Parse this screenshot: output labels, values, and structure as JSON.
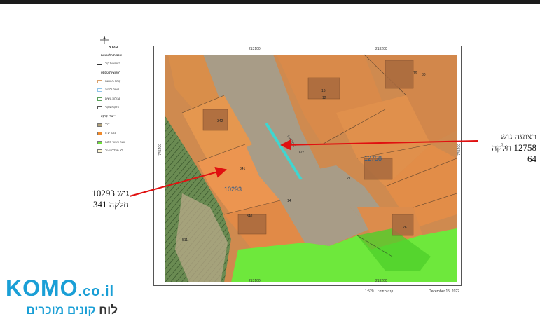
{
  "legend": {
    "title": "מקרא",
    "items": [
      {
        "label": "שכבות רלוונטיות",
        "kind": "section"
      },
      {
        "label": "רזולוציות קוד",
        "kind": "line"
      },
      {
        "label": "רזולוציות טקסט",
        "kind": "section"
      },
      {
        "label": "קומה ראשונה",
        "kind": "box",
        "color": "#d9a06b"
      },
      {
        "label": "קומה גלרייה",
        "kind": "box",
        "color": "#8fc4e8"
      },
      {
        "label": "גבולות גושים",
        "kind": "box",
        "color": "#5aa05a"
      },
      {
        "label": "חלקות מקור",
        "kind": "box",
        "color": "#555555"
      },
      {
        "label": "ייעודי קרקע",
        "kind": "section"
      },
      {
        "label": "דרך",
        "kind": "fill",
        "color": "#b3a27a"
      },
      {
        "label": "מגורים א",
        "kind": "fill",
        "color": "#f08a2c"
      },
      {
        "label": "שטח ציבורי פתוח",
        "kind": "fill",
        "color": "#6fe03a"
      },
      {
        "label": "לא מוגדרו ייעוד",
        "kind": "fill",
        "color": "#fff7d4"
      }
    ]
  },
  "map": {
    "coords_top": [
      "213100",
      "213200"
    ],
    "coords_bottom": [
      "213100",
      "213200"
    ],
    "coords_left": "745400",
    "coords_right": "745400",
    "parcel_labels": [
      {
        "text": "342"
      },
      {
        "text": "341"
      },
      {
        "text": "10293"
      },
      {
        "text": "340"
      },
      {
        "text": "127"
      },
      {
        "text": "12758"
      },
      {
        "text": "16"
      },
      {
        "text": "19"
      },
      {
        "text": "12"
      },
      {
        "text": "14"
      },
      {
        "text": "21"
      },
      {
        "text": "26"
      },
      {
        "text": "30"
      },
      {
        "text": "511"
      }
    ],
    "road_label": "MAGOR",
    "colors": {
      "road": "#a89a7f",
      "residential": "#e48b3a",
      "open_space": "#6ee83c",
      "green_hatch": "#4c7a3e"
    }
  },
  "footer": {
    "date": "December 15, 2022",
    "scale": "1:520",
    "scale_label": "קנה מידה:"
  },
  "annotations": {
    "left_line1": "גוש 10293",
    "left_line2": "חלקה 341",
    "right_line1": "רצועה גוש",
    "right_line2": "12758 חלקה",
    "right_line3": "64"
  },
  "brand": {
    "name": "KOMO",
    "tld": ".co.il",
    "sub_pre": "לוח ",
    "sub_hl1": "קונים",
    "sub_mid": " ",
    "sub_hl2": "מוכרים"
  }
}
